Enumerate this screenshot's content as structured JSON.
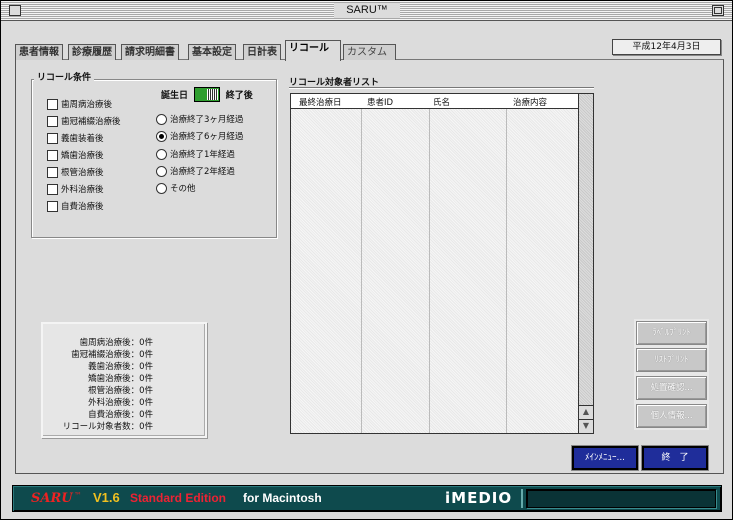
{
  "window": {
    "title": "SARU™"
  },
  "tabs": [
    {
      "label": "患者情報"
    },
    {
      "label": "診療履歴"
    },
    {
      "label": "請求明細書"
    },
    {
      "label": "基本設定"
    },
    {
      "label": "日計表"
    },
    {
      "label": "リコール"
    },
    {
      "label": "カスタム"
    }
  ],
  "date": "平成12年4月3日",
  "recall_conditions": {
    "title": "リコール条件",
    "checkboxes": [
      {
        "label": "歯周病治療後"
      },
      {
        "label": "歯冠補綴治療後"
      },
      {
        "label": "義歯装着後"
      },
      {
        "label": "矯歯治療後"
      },
      {
        "label": "根管治療後"
      },
      {
        "label": "外科治療後"
      },
      {
        "label": "自費治療後"
      }
    ],
    "toggle": {
      "left_label": "誕生日",
      "right_label": "終了後"
    },
    "radios": [
      {
        "label": "治療終了3ヶ月経過",
        "selected": false
      },
      {
        "label": "治療終了6ヶ月経過",
        "selected": true
      },
      {
        "label": "治療終了1年経過",
        "selected": false
      },
      {
        "label": "治療終了2年経過",
        "selected": false
      },
      {
        "label": "その他",
        "selected": false
      }
    ]
  },
  "recall_list": {
    "title": "リコール対象者リスト",
    "columns": [
      "最終治療日",
      "患者ID",
      "氏名",
      "治療内容"
    ],
    "rows": []
  },
  "summary": [
    "歯周病治療後：0件",
    "歯冠補綴治療後：0件",
    "義歯治療後：0件",
    "矯歯治療後：0件",
    "根管治療後：0件",
    "外科治療後：0件",
    "自費治療後：0件",
    "リコール対象者数：0件"
  ],
  "side_buttons": [
    {
      "label": "ﾗﾍﾞﾙﾌﾟﾘﾝﾄ"
    },
    {
      "label": "ﾘｽﾄﾌﾟﾘﾝﾄ"
    },
    {
      "label": "処置確認..."
    },
    {
      "label": "個人情報..."
    }
  ],
  "bottom_buttons": {
    "main_menu": "ﾒｲﾝﾒﾆｭｰ...",
    "exit": "終　了"
  },
  "footer": {
    "logo": "SARU",
    "tm": "™",
    "version": "V1.6",
    "edition": "Standard Edition",
    "platform": "for Macintosh",
    "brand": "iMEDIO"
  },
  "colors": {
    "window_bg": "#dcdcdc",
    "accent_blue": "#1f2d9a",
    "footer_bg": "#0e4a4d",
    "toggle_green": "#2f9e2f"
  }
}
